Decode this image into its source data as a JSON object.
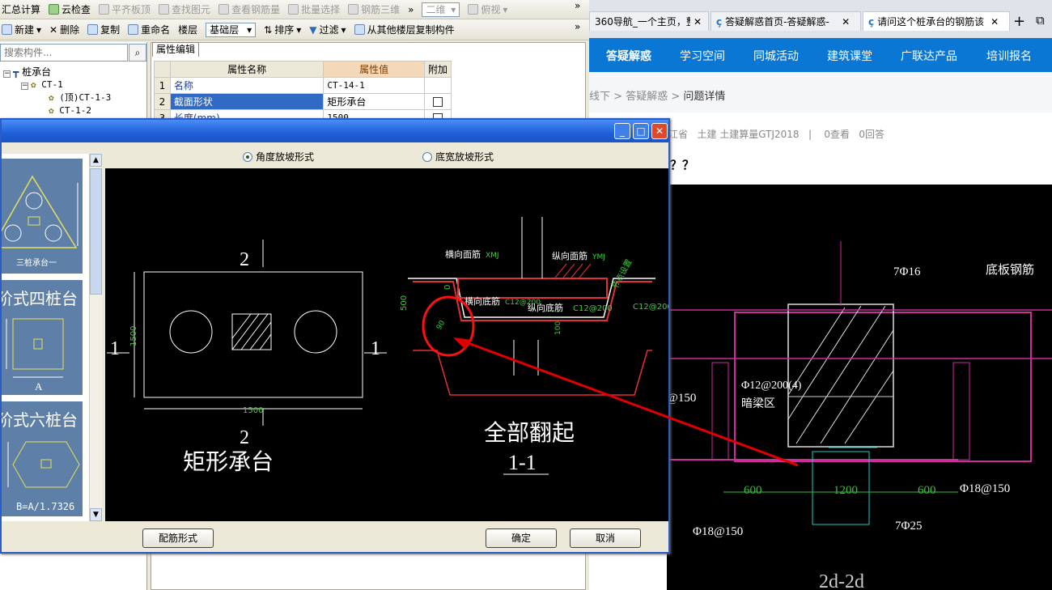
{
  "toolbar1": {
    "summary": "汇总计算",
    "cloud_check": "云检查",
    "flat_roof": "平齐板顶",
    "find_element": "查找图元",
    "view_rebar": "查看钢筋量",
    "batch_select": "批量选择",
    "rebar_3d": "钢筋三维",
    "view_mode": "二维",
    "view_angle": "俯视"
  },
  "toolbar2": {
    "new": "新建",
    "delete": "删除",
    "copy": "复制",
    "rename": "重命名",
    "floor_label": "楼层",
    "floor_value": "基础层",
    "sort": "排序",
    "filter": "过滤",
    "copy_from_floor": "从其他楼层复制构件"
  },
  "search": {
    "placeholder": "搜索构件..."
  },
  "tree": {
    "root": "桩承台",
    "child": "CT-1",
    "items": [
      "(顶)CT-1-3",
      "CT-1-2"
    ]
  },
  "props": {
    "tab": "属性编辑",
    "headers": [
      "属性名称",
      "属性值",
      "附加"
    ],
    "rows": [
      {
        "num": "1",
        "name": "名称",
        "value": "CT-14-1"
      },
      {
        "num": "2",
        "name": "截面形状",
        "value": "矩形承台"
      },
      {
        "num": "3",
        "name": "长度(mm)",
        "value": "1500"
      }
    ]
  },
  "browser": {
    "tabs": [
      "360导航_一个主页，整个",
      "答疑解惑首页-答疑解惑-",
      "请问这个桩承台的钢筋该"
    ],
    "nav": [
      "答疑解惑",
      "学习空间",
      "同城活动",
      "建筑课堂",
      "广联达产品",
      "培训报名"
    ],
    "breadcrumb": [
      "线下",
      "答疑解惑",
      "问题详情"
    ],
    "meta": {
      "region": "江省",
      "category": "土建 土建算量GTJ2018",
      "views": "0查看",
      "answers": "0回答"
    },
    "title_tail": "？？",
    "drawing": {
      "rebar1": "7Φ16",
      "bottom_rebar": "底板钢筋",
      "stirrup": "Φ12@200(4)",
      "zone": "暗梁区",
      "left_rebar": "@150",
      "dims": [
        "600",
        "1200",
        "600"
      ],
      "right_rebar": "Φ18@150",
      "bottom_left_rebar": "Φ18@150",
      "bottom_main": "7Φ25",
      "section": "2d-2d"
    }
  },
  "dialog": {
    "radio1": "角度放坡形式",
    "radio2": "底宽放坡形式",
    "thumbs": {
      "three_pile": "三桩承台一",
      "four_pile": "阶式四桩台",
      "four_dim": "A",
      "six_pile": "阶式六桩台",
      "six_formula": "B=A/1.7326"
    },
    "cad": {
      "sec_top": "2",
      "sec_bottom": "2",
      "left_mark": "1",
      "right_mark": "1",
      "dim_h": "1500",
      "dim_v": "1500",
      "caption": "矩形承台",
      "h_top": "横向面筋",
      "h_top_code": "XMJ",
      "v_top": "纵向面筋",
      "v_top_code": "YMJ",
      "side": "节点设置",
      "h_bot": "横向底筋",
      "h_bot_code": "C12@200",
      "v_bot": "纵向底筋",
      "v_bot_code": "C12@200",
      "side_code": "C12@200",
      "dim500": "500",
      "dim0": "0",
      "dim90": "90",
      "dim100": "100",
      "note": "全部翻起",
      "section": "1-1"
    },
    "btn_rebar_form": "配筋形式",
    "btn_ok": "确定",
    "btn_cancel": "取消"
  }
}
